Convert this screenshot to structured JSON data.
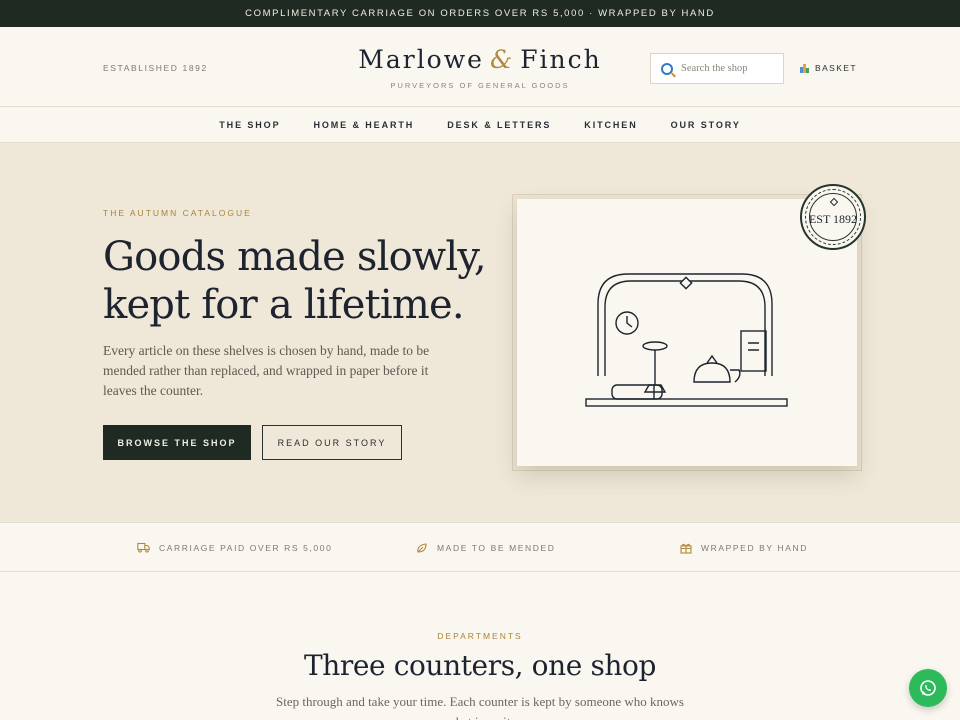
{
  "announcement": "COMPLIMENTARY CARRIAGE ON ORDERS OVER RS 5,000 · WRAPPED BY HAND",
  "header": {
    "established": "ESTABLISHED 1892",
    "brand_first": "Marlowe",
    "brand_amp": "&",
    "brand_second": "Finch",
    "tagline": "PURVEYORS OF GENERAL GOODS",
    "search_placeholder": "Search the shop",
    "basket_label": "BASKET"
  },
  "nav": {
    "items": [
      "THE SHOP",
      "HOME & HEARTH",
      "DESK & LETTERS",
      "KITCHEN",
      "OUR STORY"
    ]
  },
  "hero": {
    "eyebrow": "THE AUTUMN CATALOGUE",
    "headline_line1": "Goods made slowly,",
    "headline_line2": "kept for a lifetime.",
    "lede": "Every article on these shelves is chosen by hand, made to be mended rather than replaced, and wrapped in paper before it leaves the counter.",
    "primary_cta": "BROWSE THE SHOP",
    "secondary_cta": "READ OUR STORY",
    "seal_text": "EST 1892"
  },
  "features": [
    {
      "label": "CARRIAGE PAID OVER RS 5,000",
      "icon": "truck-icon"
    },
    {
      "label": "MADE TO BE MENDED",
      "icon": "leaf-icon"
    },
    {
      "label": "WRAPPED BY HAND",
      "icon": "gift-icon"
    }
  ],
  "departments": {
    "eyebrow": "DEPARTMENTS",
    "title": "Three counters, one shop",
    "lede": "Step through and take your time. Each counter is kept by someone who knows what is on it."
  },
  "colors": {
    "dark_green": "#1f2a22",
    "gold": "#a9843c",
    "hero_bg": "#efe7d8",
    "page_bg": "#faf7f1",
    "whatsapp_green": "#2dba5b"
  }
}
